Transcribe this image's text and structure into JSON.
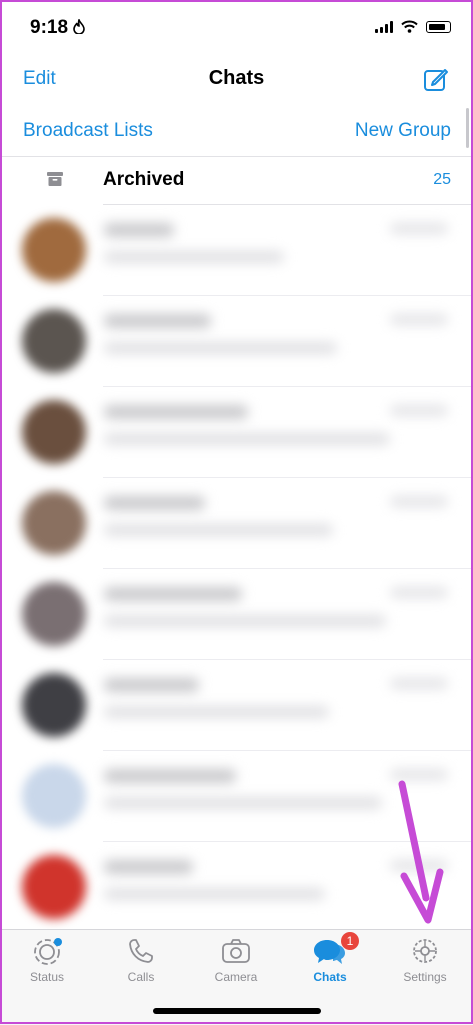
{
  "status_bar": {
    "time": "9:18",
    "flame_glyph": "🔥"
  },
  "nav": {
    "edit_label": "Edit",
    "title": "Chats",
    "compose_icon": "compose-icon"
  },
  "subnav": {
    "broadcast_label": "Broadcast Lists",
    "new_group_label": "New Group"
  },
  "archived": {
    "label": "Archived",
    "count": "25"
  },
  "chats": [
    {
      "avatar_color": "#a06a3e"
    },
    {
      "avatar_color": "#5b5550"
    },
    {
      "avatar_color": "#6a4f3e"
    },
    {
      "avatar_color": "#8a7060"
    },
    {
      "avatar_color": "#7a6f72"
    },
    {
      "avatar_color": "#3f3f44"
    },
    {
      "avatar_color": "#c9d7ea"
    },
    {
      "avatar_color": "#d0342c"
    }
  ],
  "tabs": [
    {
      "label": "Status",
      "icon": "status-icon"
    },
    {
      "label": "Calls",
      "icon": "phone-icon"
    },
    {
      "label": "Camera",
      "icon": "camera-icon"
    },
    {
      "label": "Chats",
      "icon": "chats-icon",
      "badge": "1"
    },
    {
      "label": "Settings",
      "icon": "gear-icon"
    }
  ],
  "colors": {
    "accent": "#1a8ddd",
    "annotation": "#c64bd6",
    "badge": "#e8453c"
  }
}
